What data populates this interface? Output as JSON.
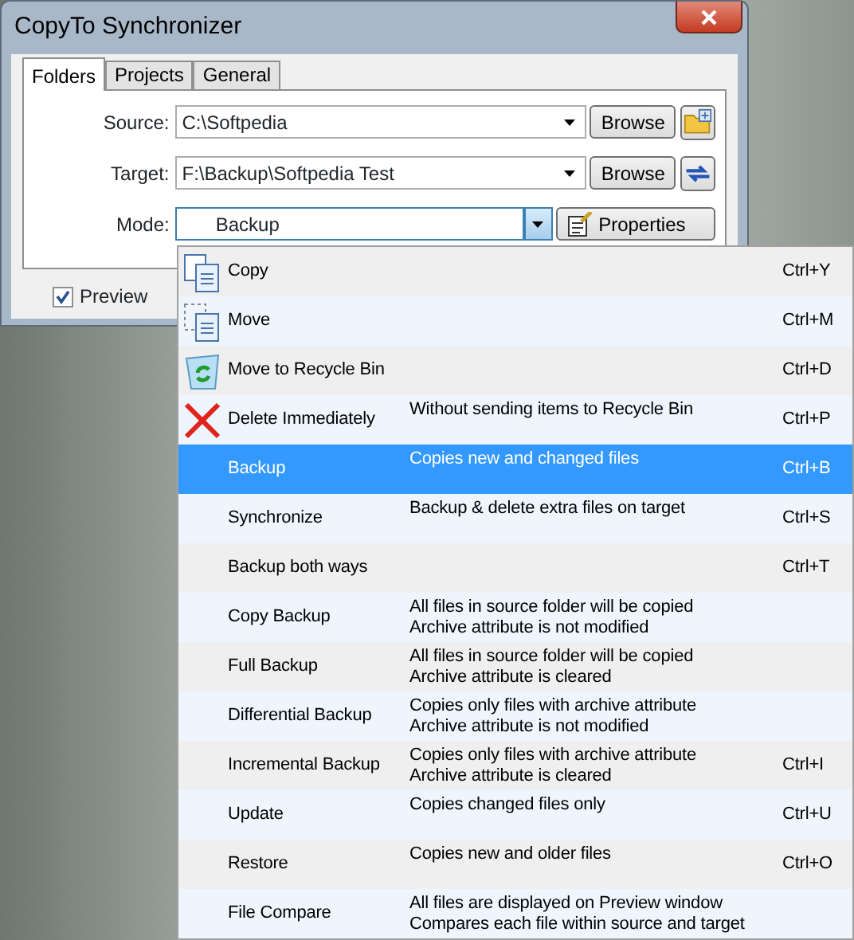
{
  "window": {
    "title": "CopyTo Synchronizer"
  },
  "tabs": [
    {
      "label": "Folders",
      "selected": true
    },
    {
      "label": "Projects",
      "selected": false
    },
    {
      "label": "General",
      "selected": false
    }
  ],
  "fields": [
    {
      "label": "Source:",
      "value": "C:\\Softpedia",
      "button": "Browse",
      "kind": "folder"
    },
    {
      "label": "Target:",
      "value": "F:\\Backup\\Softpedia Test",
      "button": "Browse",
      "kind": "swap"
    }
  ],
  "mode": {
    "label": "Mode:",
    "value": "Backup",
    "button": "Properties"
  },
  "preview": {
    "label": "Preview",
    "checked": true
  },
  "modes": [
    {
      "label": "Copy",
      "kind": "copy",
      "shortcut": "Ctrl+Y",
      "selected": false
    },
    {
      "label": "Move",
      "kind": "move",
      "shortcut": "Ctrl+M",
      "selected": false
    },
    {
      "label": "Move to Recycle Bin",
      "kind": "recycle",
      "shortcut": "Ctrl+D",
      "selected": false
    },
    {
      "label": "Delete Immediately",
      "kind": "delete",
      "description": [
        "Without sending items to Recycle Bin"
      ],
      "shortcut": "Ctrl+P",
      "selected": false
    },
    {
      "label": "Backup",
      "description": [
        "Copies new and changed files"
      ],
      "shortcut": "Ctrl+B",
      "selected": true
    },
    {
      "label": "Synchronize",
      "description": [
        "Backup & delete extra files on target"
      ],
      "shortcut": "Ctrl+S",
      "selected": false
    },
    {
      "label": "Backup both ways",
      "shortcut": "Ctrl+T",
      "selected": false
    },
    {
      "label": "Copy Backup",
      "description": [
        "All files in source folder will be copied",
        "Archive attribute is not modified"
      ],
      "selected": false
    },
    {
      "label": "Full Backup",
      "description": [
        "All files in source folder will be copied",
        "Archive attribute is cleared"
      ],
      "selected": false
    },
    {
      "label": "Differential Backup",
      "description": [
        "Copies only files with archive attribute",
        "Archive attribute is not modified"
      ],
      "selected": false
    },
    {
      "label": "Incremental Backup",
      "description": [
        "Copies only files with archive attribute",
        "Archive attribute is cleared"
      ],
      "shortcut": "Ctrl+I",
      "selected": false
    },
    {
      "label": "Update",
      "description": [
        "Copies changed files only"
      ],
      "shortcut": "Ctrl+U",
      "selected": false
    },
    {
      "label": "Restore",
      "description": [
        "Copies new and older files"
      ],
      "shortcut": "Ctrl+O",
      "selected": false
    },
    {
      "label": "File Compare",
      "description": [
        "All files are displayed on Preview window",
        "Compares each file within source and target"
      ],
      "selected": false
    }
  ]
}
